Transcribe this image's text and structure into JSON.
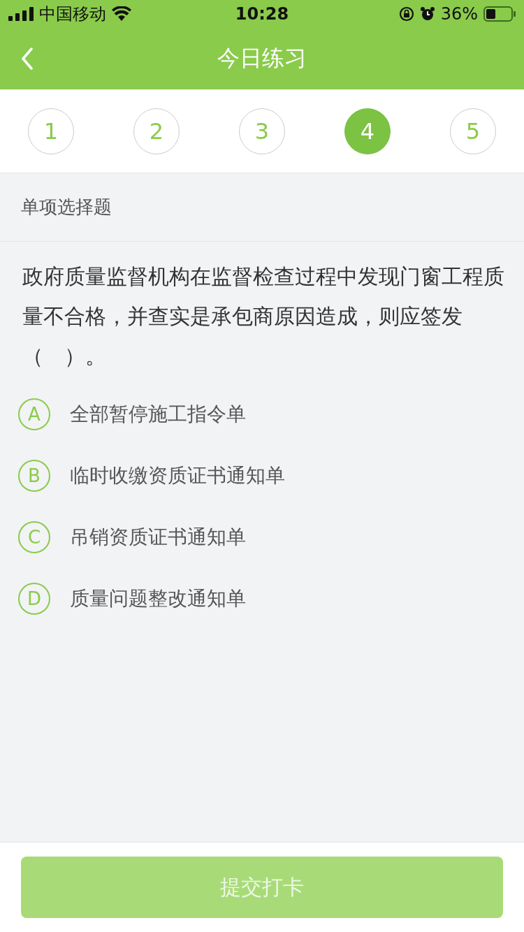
{
  "status_bar": {
    "carrier": "中国移动",
    "time": "10:28",
    "battery": "36%"
  },
  "nav": {
    "title": "今日练习"
  },
  "steps": [
    {
      "label": "1",
      "selected": false
    },
    {
      "label": "2",
      "selected": false
    },
    {
      "label": "3",
      "selected": false
    },
    {
      "label": "4",
      "selected": true
    },
    {
      "label": "5",
      "selected": false
    }
  ],
  "question": {
    "type": "单项选择题",
    "text": "政府质量监督机构在监督检查过程中发现门窗工程质量不合格，并查实是承包商原因造成，则应签发（　）。",
    "options": [
      {
        "letter": "A",
        "text": "全部暂停施工指令单",
        "selected": false
      },
      {
        "letter": "B",
        "text": "临时收缴资质证书通知单",
        "selected": false
      },
      {
        "letter": "C",
        "text": "吊销资质证书通知单",
        "selected": false
      },
      {
        "letter": "D",
        "text": "质量问题整改通知单",
        "selected": false
      }
    ]
  },
  "submit": {
    "label": "提交打卡",
    "disabled": true
  }
}
